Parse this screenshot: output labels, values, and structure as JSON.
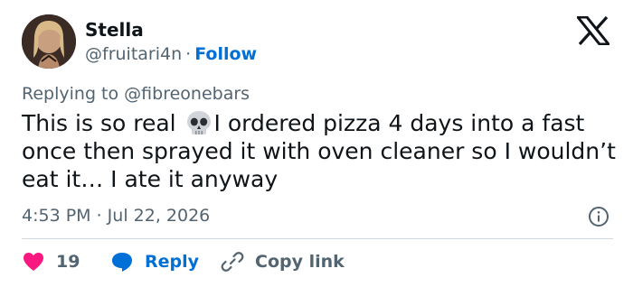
{
  "author": {
    "name": "Stella",
    "handle": "@fruitari4n",
    "separator": "·",
    "follow_label": "Follow"
  },
  "reply_context": {
    "prefix": "Replying to",
    "target": "@fibreonebars"
  },
  "tweet": {
    "text_before_emoji": "This is so real ",
    "emoji": "skull",
    "text_after_emoji": "I ordered pizza 4 days into a fast once then sprayed it with oven cleaner so I wouldn’t eat it… I ate it anyway",
    "timestamp": "4:53 PM · Jul 22, 2026"
  },
  "actions": {
    "likes": "19",
    "reply_label": "Reply",
    "copy_label": "Copy link"
  },
  "colors": {
    "link_blue": "#006fd6",
    "heart_red": "#f91880",
    "muted_gray": "#536471"
  },
  "icons": [
    "x-logo-icon",
    "info-icon",
    "heart-icon",
    "reply-bubble-icon",
    "link-icon"
  ]
}
